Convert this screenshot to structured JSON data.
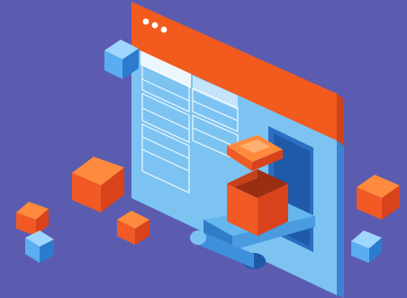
{
  "scene": {
    "name": "isometric-web-window-with-boxes",
    "background_color": "#5b5cb0",
    "window": {
      "header_color": "#f25a1e",
      "body_color": "#7cc3f2",
      "header_dots_color": "#ffffff",
      "panel_line_color": "#ffffff",
      "icons": [
        "window-dots-icon"
      ]
    },
    "conveyor": {
      "color": "#63b7ee",
      "shadow_color": "#2f7cc7"
    },
    "boxes": {
      "orange_top": "#ff8a3d",
      "orange_left": "#f15a24",
      "orange_right": "#d9431c",
      "blue_top": "#9fd6ff",
      "blue_left": "#5aaef0",
      "blue_right": "#2b7ccf"
    }
  }
}
